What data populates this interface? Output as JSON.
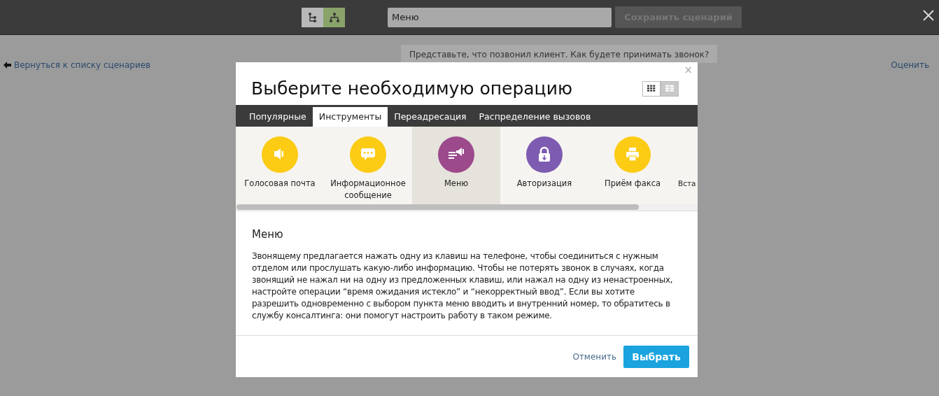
{
  "toolbar": {
    "view_toggles": [
      {
        "kind": "tree",
        "selected": false
      },
      {
        "kind": "flow",
        "selected": true
      }
    ],
    "scenario_name": "Меню",
    "save_button": {
      "label": "Сохранить сценарий",
      "disabled": true
    }
  },
  "back_link": "Вернуться к списку сценариев",
  "prompt": "Представьте, что позвонил клиент. Как будете принимать звонок?",
  "rate_link": "Оценить",
  "dialog": {
    "title": "Выберите необходимую операцию",
    "layouts": [
      {
        "kind": "grid",
        "selected": true
      },
      {
        "kind": "list",
        "selected": false
      }
    ],
    "tabs": [
      {
        "label": "Популярные",
        "selected": false
      },
      {
        "label": "Инструменты",
        "selected": true
      },
      {
        "label": "Переадресация",
        "selected": false
      },
      {
        "label": "Распределение вызовов",
        "selected": false
      }
    ],
    "operations": [
      {
        "label": "Голосовая почта",
        "kind": "speaker",
        "color": "#fccb14",
        "selected": false
      },
      {
        "label": "Информационное сообщение",
        "kind": "chat",
        "color": "#fccb14",
        "selected": false
      },
      {
        "label": "Меню",
        "kind": "menu",
        "color": "#9c4a8c",
        "selected": true
      },
      {
        "label": "Авторизация",
        "kind": "lock",
        "color": "#7d5bb1",
        "selected": false
      },
      {
        "label": "Приём факса",
        "kind": "printer",
        "color": "#fccb14",
        "selected": false
      },
      {
        "label": "Вста",
        "kind": "none",
        "selected": false
      }
    ],
    "detail_title": "Меню",
    "detail_text": "Звонящему предлагается нажать одну из клавиш на телефоне, чтобы соединиться с нужным отделом или прослушать какую-либо информацию. Чтобы не потерять звонок в случаях, когда звонящий не нажал ни на одну из предложенных клавиш, или нажал на одну из ненастроенных, настройте операции “время ожидания истекло” и “некорректный ввод”. Если вы хотите разрешить одновременно с выбором пункта меню вводить и внутренний номер, то обратитесь в службу консалтинга: они помогут настроить работу в таком режиме.",
    "close": "×",
    "cancel": "Отменить",
    "confirm": "Выбрать"
  }
}
